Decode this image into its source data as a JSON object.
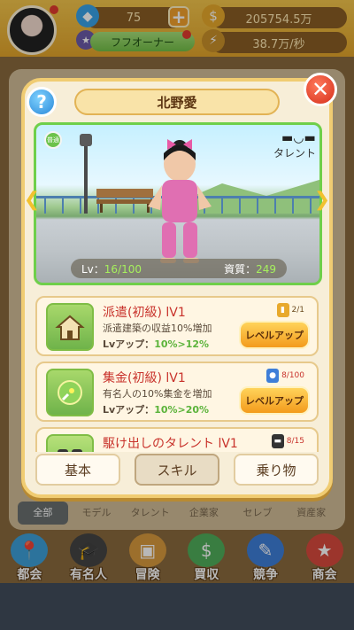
{
  "header": {
    "gems": "75",
    "coins": "205754.5万",
    "rank_title": "フフオーナー",
    "income": "38.7万/秒"
  },
  "background": {
    "tabs": [
      "全部",
      "モデル",
      "タレント",
      "企業家",
      "セレブ",
      "資産家"
    ]
  },
  "nav": {
    "items": [
      {
        "label": "都会",
        "icon": "city-icon",
        "color": "#3ea0d8"
      },
      {
        "label": "有名人",
        "icon": "graduate-icon",
        "color": "#444444"
      },
      {
        "label": "冒険",
        "icon": "treasure-chest-icon",
        "color": "#d89a3e"
      },
      {
        "label": "買収",
        "icon": "money-bag-icon",
        "color": "#4fae5a"
      },
      {
        "label": "競争",
        "icon": "clipboard-icon",
        "color": "#3e7ed8"
      },
      {
        "label": "商会",
        "icon": "banner-icon",
        "color": "#d84a3e"
      }
    ]
  },
  "popup": {
    "title": "北野愛",
    "help": "?",
    "close": "✕",
    "rank_badge": "普通",
    "talent_label": "タレント",
    "lv_label": "Lv：",
    "lv_value": "16/100",
    "capital_label": "資質：",
    "capital_value": "249",
    "skills": [
      {
        "name": "派遣(初級) lV1",
        "desc": "派遣建築の収益10%増加",
        "up_label": "Lvアップ：",
        "up_value": "10%>12%",
        "count": "2/1",
        "icon": "house-icon",
        "button": "レベルアップ"
      },
      {
        "name": "集金(初級) lV1",
        "desc": "有名人の10%集金を増加",
        "up_label": "Lvアップ：",
        "up_value": "10%>20%",
        "count": "8/100",
        "icon": "coin-collect-icon",
        "button": "レベルアップ"
      },
      {
        "name": "駆け出しのタレント lV1",
        "count": "8/15",
        "icon": "sunglasses-icon"
      }
    ],
    "tabs": [
      "基本",
      "スキル",
      "乗り物"
    ]
  },
  "colors": {
    "accent": "#f39b1c",
    "green": "#6fcf4a",
    "danger": "#d52e1a"
  }
}
